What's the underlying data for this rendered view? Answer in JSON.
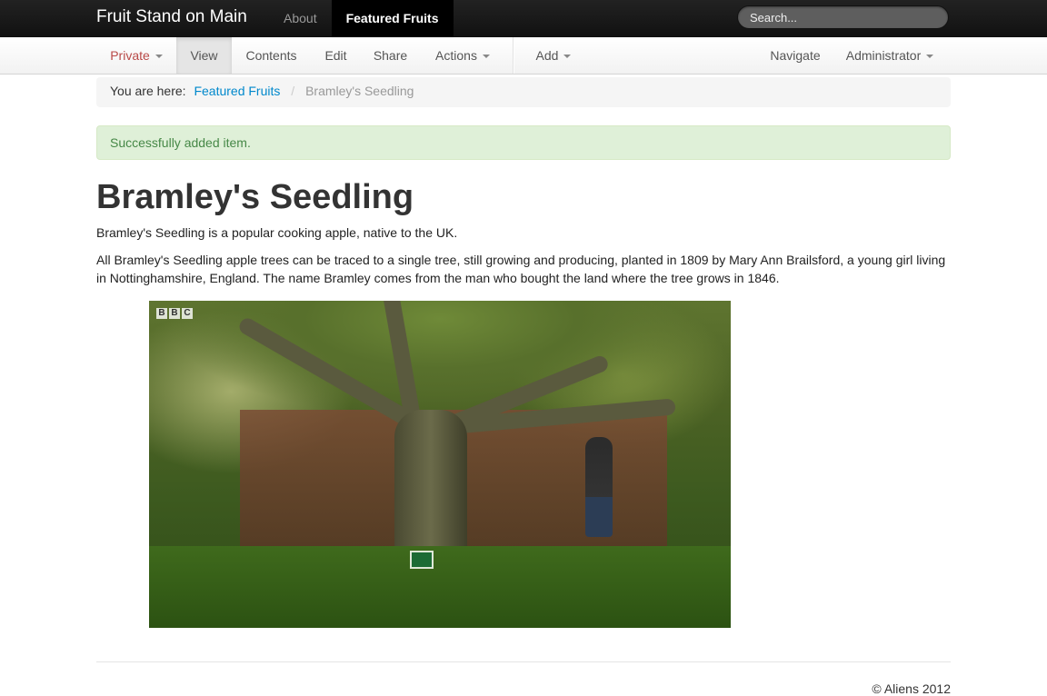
{
  "navbar": {
    "brand": "Fruit Stand on Main",
    "items": [
      {
        "label": "About",
        "active": false
      },
      {
        "label": "Featured Fruits",
        "active": true
      }
    ],
    "search_placeholder": "Search..."
  },
  "toolbar": {
    "private": "Private",
    "view": "View",
    "contents": "Contents",
    "edit": "Edit",
    "share": "Share",
    "actions": "Actions",
    "add": "Add",
    "navigate": "Navigate",
    "administrator": "Administrator"
  },
  "breadcrumb": {
    "prefix": "You are here:",
    "link": "Featured Fruits",
    "separator": "/",
    "current": "Bramley's Seedling"
  },
  "alert": {
    "message": "Successfully added item."
  },
  "content": {
    "title": "Bramley's Seedling",
    "description": "Bramley's Seedling is a popular cooking apple, native to the UK.",
    "body": "All Bramley's Seedling apple trees can be traced to a single tree, still growing and producing, planted in 1809 by Mary Ann Brailsford, a young girl living in Nottinghamshire, England. The name Bramley comes from the man who bought the land where the tree grows in 1846.",
    "image": {
      "watermark": [
        "B",
        "B",
        "C"
      ]
    }
  },
  "footer": {
    "text": "© Aliens 2012"
  },
  "colors": {
    "link": "#0088cc",
    "private": "#b94a48",
    "alert_bg": "#dff0d8",
    "alert_text": "#468847"
  }
}
